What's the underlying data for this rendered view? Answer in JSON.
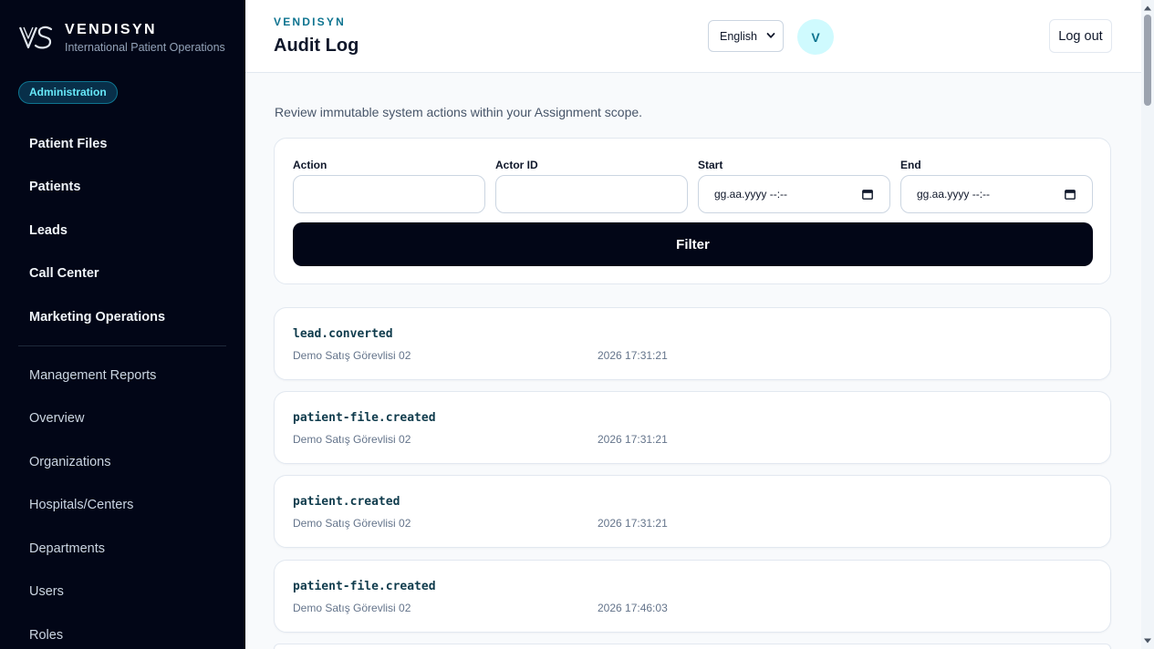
{
  "brand": {
    "name": "VENDISYN",
    "subtitle": "International Patient Operations"
  },
  "sidebar": {
    "role_badge": "Administration",
    "primary": [
      "Patient Files",
      "Patients",
      "Leads",
      "Call Center",
      "Marketing Operations"
    ],
    "secondary": [
      "Management Reports",
      "Overview",
      "Organizations",
      "Hospitals/Centers",
      "Departments",
      "Users",
      "Roles"
    ]
  },
  "header": {
    "eyebrow": "VENDISYN",
    "title": "Audit Log",
    "language": "English",
    "avatar_initial": "V",
    "logout_label": "Log out"
  },
  "main": {
    "intro": "Review immutable system actions within your Assignment scope.",
    "filters": {
      "action_label": "Action",
      "actor_label": "Actor ID",
      "start_label": "Start",
      "end_label": "End",
      "start_placeholder": "gg.aa.yyyy --:--",
      "end_placeholder": "gg.aa.yyyy --:--",
      "button_label": "Filter"
    },
    "logs": [
      {
        "action": "lead.converted",
        "actor": "Demo Satış Görevlisi 02",
        "time": "2026 17:31:21"
      },
      {
        "action": "patient-file.created",
        "actor": "Demo Satış Görevlisi 02",
        "time": "2026 17:31:21"
      },
      {
        "action": "patient.created",
        "actor": "Demo Satış Görevlisi 02",
        "time": "2026 17:31:21"
      },
      {
        "action": "patient-file.created",
        "actor": "Demo Satış Görevlisi 02",
        "time": "2026 17:46:03"
      }
    ]
  },
  "colors": {
    "sidebar_bg": "#020617",
    "accent": "#0e7490",
    "badge_text": "#67e8f9",
    "avatar_bg": "#cffafe"
  },
  "icons": [
    "vendisyn-logo-icon",
    "chevron-down-icon",
    "calendar-icon"
  ]
}
